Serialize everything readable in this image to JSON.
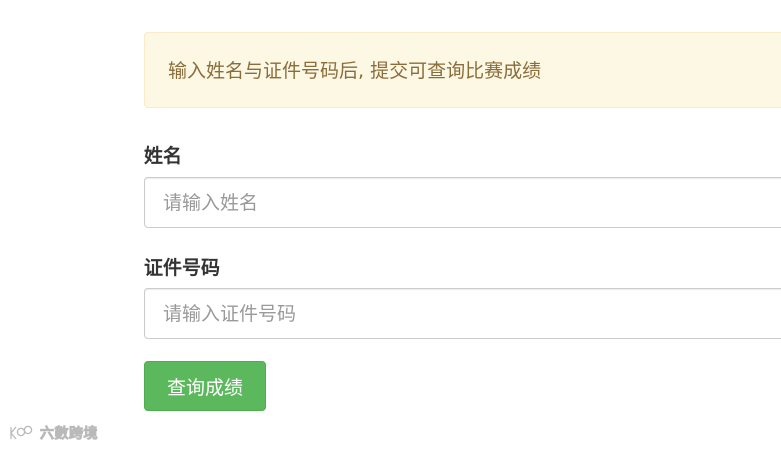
{
  "notice": {
    "text": "输入姓名与证件号码后, 提交可查询比赛成绩"
  },
  "form": {
    "name_label": "姓名",
    "name_placeholder": "请输入姓名",
    "name_value": "",
    "id_label": "证件号码",
    "id_placeholder": "请输入证件号码",
    "id_value": "",
    "submit_label": "查询成绩"
  },
  "watermark": {
    "text": "六數跨境"
  },
  "colors": {
    "notice_background": "#fcf8e3",
    "notice_text": "#8a6d3b",
    "submit_background": "#5cb85c"
  }
}
